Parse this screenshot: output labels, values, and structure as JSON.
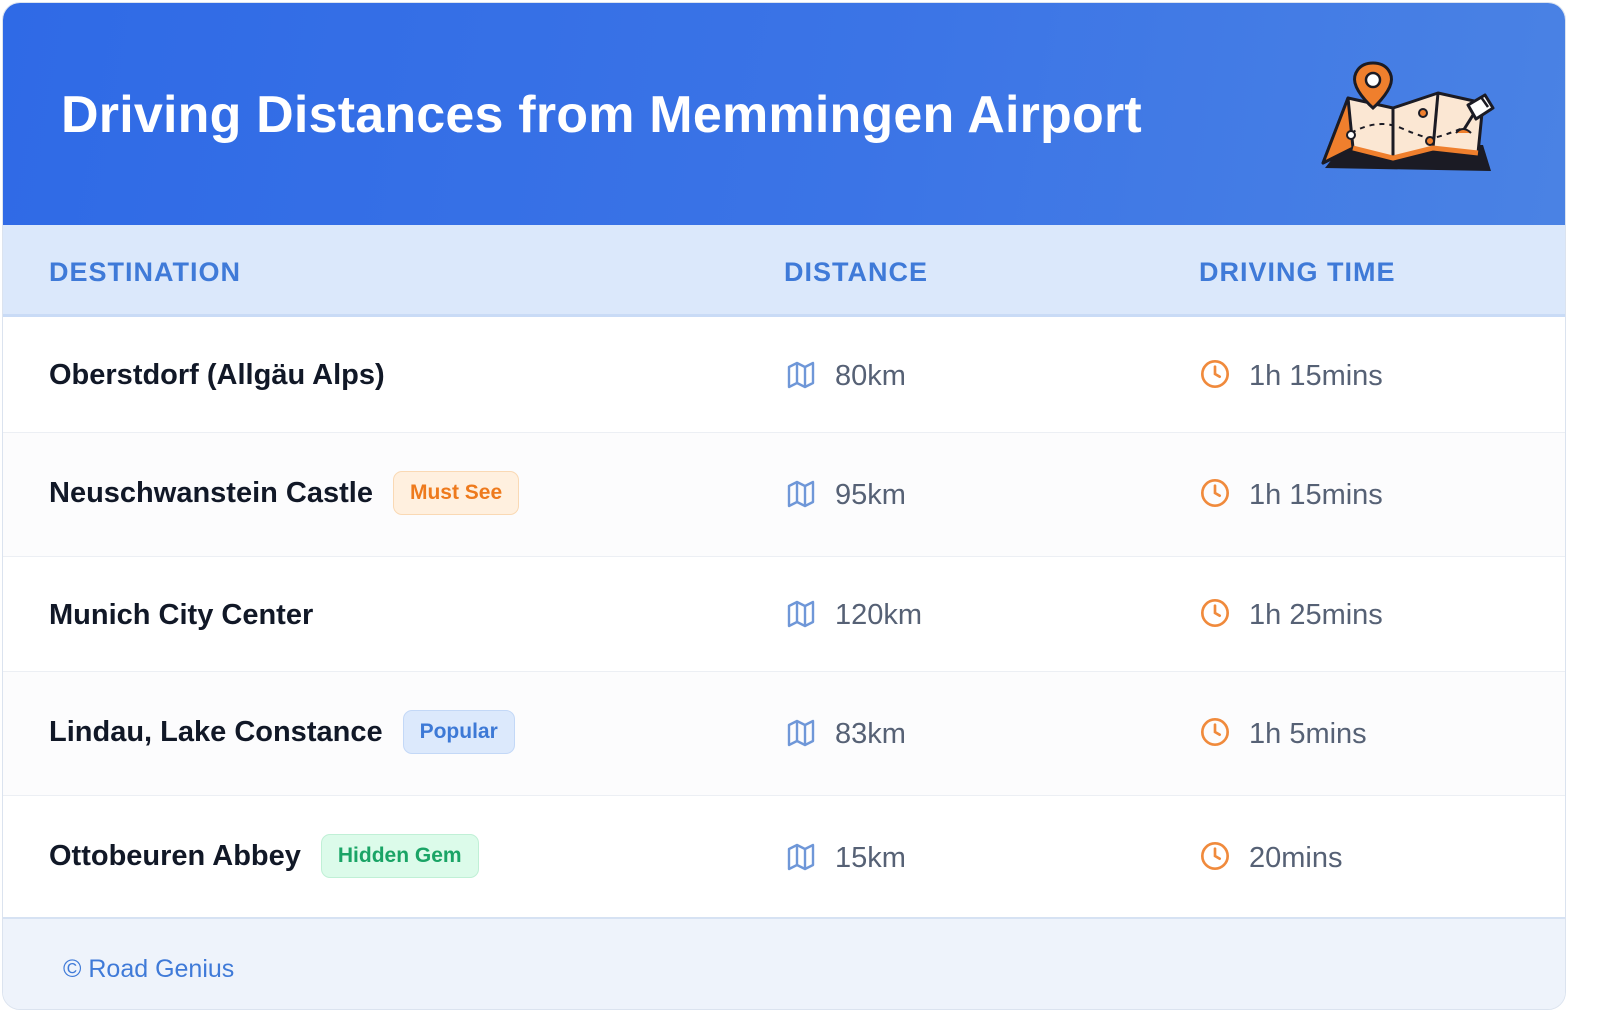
{
  "header": {
    "title": "Driving Distances from Memmingen Airport",
    "illustration_icon": "map-with-pin-icon",
    "background_color": "#3570e6"
  },
  "table": {
    "columns": [
      "DESTINATION",
      "DISTANCE",
      "DRIVING TIME"
    ],
    "distance_icon": "map-icon",
    "time_icon": "clock-icon",
    "rows": [
      {
        "destination": "Oberstdorf (Allgäu Alps)",
        "badge": "",
        "badge_color": "",
        "distance": "80km",
        "time": "1h 15mins"
      },
      {
        "destination": "Neuschwanstein Castle",
        "badge": "Must See",
        "badge_color": "#ee7a1d",
        "distance": "95km",
        "time": "1h 15mins"
      },
      {
        "destination": "Munich City Center",
        "badge": "",
        "badge_color": "",
        "distance": "120km",
        "time": "1h 25mins"
      },
      {
        "destination": "Lindau, Lake Constance",
        "badge": "Popular",
        "badge_color": "#3d79d6",
        "distance": "83km",
        "time": "1h 5mins"
      },
      {
        "destination": "Ottobeuren Abbey",
        "badge": "Hidden Gem",
        "badge_color": "#1aa466",
        "distance": "15km",
        "time": "20mins"
      }
    ]
  },
  "footer": {
    "copyright": "© Road Genius"
  },
  "colors": {
    "accent": "#3f7ad8",
    "icon_orange": "#f08a3c",
    "icon_blue": "#6f97d8"
  }
}
